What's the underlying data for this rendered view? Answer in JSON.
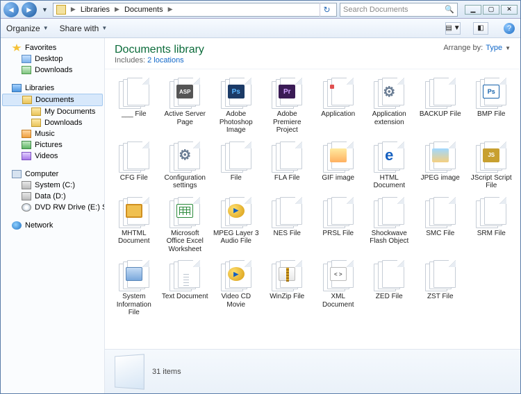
{
  "breadcrumb": {
    "seg1": "Libraries",
    "seg2": "Documents"
  },
  "search": {
    "placeholder": "Search Documents"
  },
  "cmdbar": {
    "organize": "Organize",
    "share": "Share with"
  },
  "nav": {
    "favorites": {
      "label": "Favorites",
      "desktop": "Desktop",
      "downloads": "Downloads"
    },
    "libraries": {
      "label": "Libraries",
      "documents": "Documents",
      "mydocs": "My Documents",
      "libdl": "Downloads",
      "music": "Music",
      "pictures": "Pictures",
      "videos": "Videos"
    },
    "computer": {
      "label": "Computer",
      "c": "System (C:)",
      "d": "Data (D:)",
      "e": "DVD RW Drive (E:) Sof"
    },
    "network": {
      "label": "Network"
    }
  },
  "library": {
    "title": "Documents library",
    "includes_prefix": "Includes:",
    "includes_link": "2 locations",
    "arrange_label": "Arrange by:",
    "arrange_value": "Type"
  },
  "files": [
    {
      "label": "___ File",
      "badge": ""
    },
    {
      "label": "Active Server Page",
      "badge": "asp"
    },
    {
      "label": "Adobe Photoshop Image",
      "badge": "ps"
    },
    {
      "label": "Adobe Premiere Project",
      "badge": "pr"
    },
    {
      "label": "Application",
      "badge": "app"
    },
    {
      "label": "Application extension",
      "badge": "gear"
    },
    {
      "label": "BACKUP File",
      "badge": ""
    },
    {
      "label": "BMP File",
      "badge": "bmp"
    },
    {
      "label": "CFG File",
      "badge": ""
    },
    {
      "label": "Configuration settings",
      "badge": "gear"
    },
    {
      "label": "File",
      "badge": ""
    },
    {
      "label": "FLA File",
      "badge": ""
    },
    {
      "label": "GIF image",
      "badge": "gif"
    },
    {
      "label": "HTML Document",
      "badge": "html"
    },
    {
      "label": "JPEG image",
      "badge": "jpeg"
    },
    {
      "label": "JScript Script File",
      "badge": "js"
    },
    {
      "label": "MHTML Document",
      "badge": "mht"
    },
    {
      "label": "Microsoft Office Excel Worksheet",
      "badge": "xls"
    },
    {
      "label": "MPEG Layer 3 Audio File",
      "badge": "mp3"
    },
    {
      "label": "NES File",
      "badge": ""
    },
    {
      "label": "PRSL File",
      "badge": ""
    },
    {
      "label": "Shockwave Flash Object",
      "badge": ""
    },
    {
      "label": "SMC File",
      "badge": ""
    },
    {
      "label": "SRM File",
      "badge": ""
    },
    {
      "label": "System Information File",
      "badge": "sys"
    },
    {
      "label": "Text Document",
      "badge": "txt"
    },
    {
      "label": "Video CD Movie",
      "badge": "mp3"
    },
    {
      "label": "WinZip File",
      "badge": "zip"
    },
    {
      "label": "XML Document",
      "badge": "xml"
    },
    {
      "label": "ZED File",
      "badge": ""
    },
    {
      "label": "ZST File",
      "badge": ""
    }
  ],
  "details": {
    "count": "31 items"
  }
}
